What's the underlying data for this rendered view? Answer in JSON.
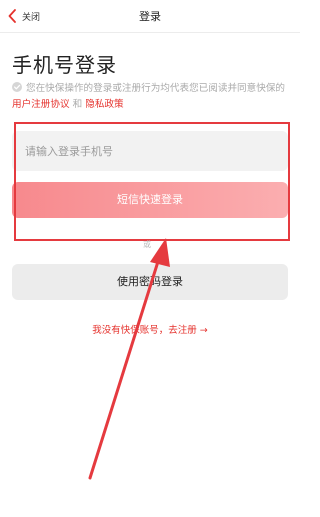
{
  "nav": {
    "close_label": "关闭",
    "title": "登录"
  },
  "page_title": "手机号登录",
  "agreement": {
    "checked": false,
    "text_before": "您在快保操作的登录或注册行为均代表您已阅读并同意快保的 ",
    "link_user": "用户注册协议",
    "text_and": " 和 ",
    "link_privacy": "隐私政策"
  },
  "phone_input": {
    "placeholder": "请输入登录手机号",
    "value": ""
  },
  "sms_button_label": "短信快速登录",
  "or_text": "或",
  "password_button_label": "使用密码登录",
  "register_link": "我没有快保账号，去注册 →",
  "colors": {
    "accent": "#e5322d",
    "sms_button_start": "#f7898d",
    "sms_button_end": "#fbaeb0",
    "annotation": "#e53a3f"
  },
  "icons": {
    "back": "chevron-left-icon",
    "check": "check-circle-icon",
    "annotation_arrow": "arrow-up-icon"
  }
}
